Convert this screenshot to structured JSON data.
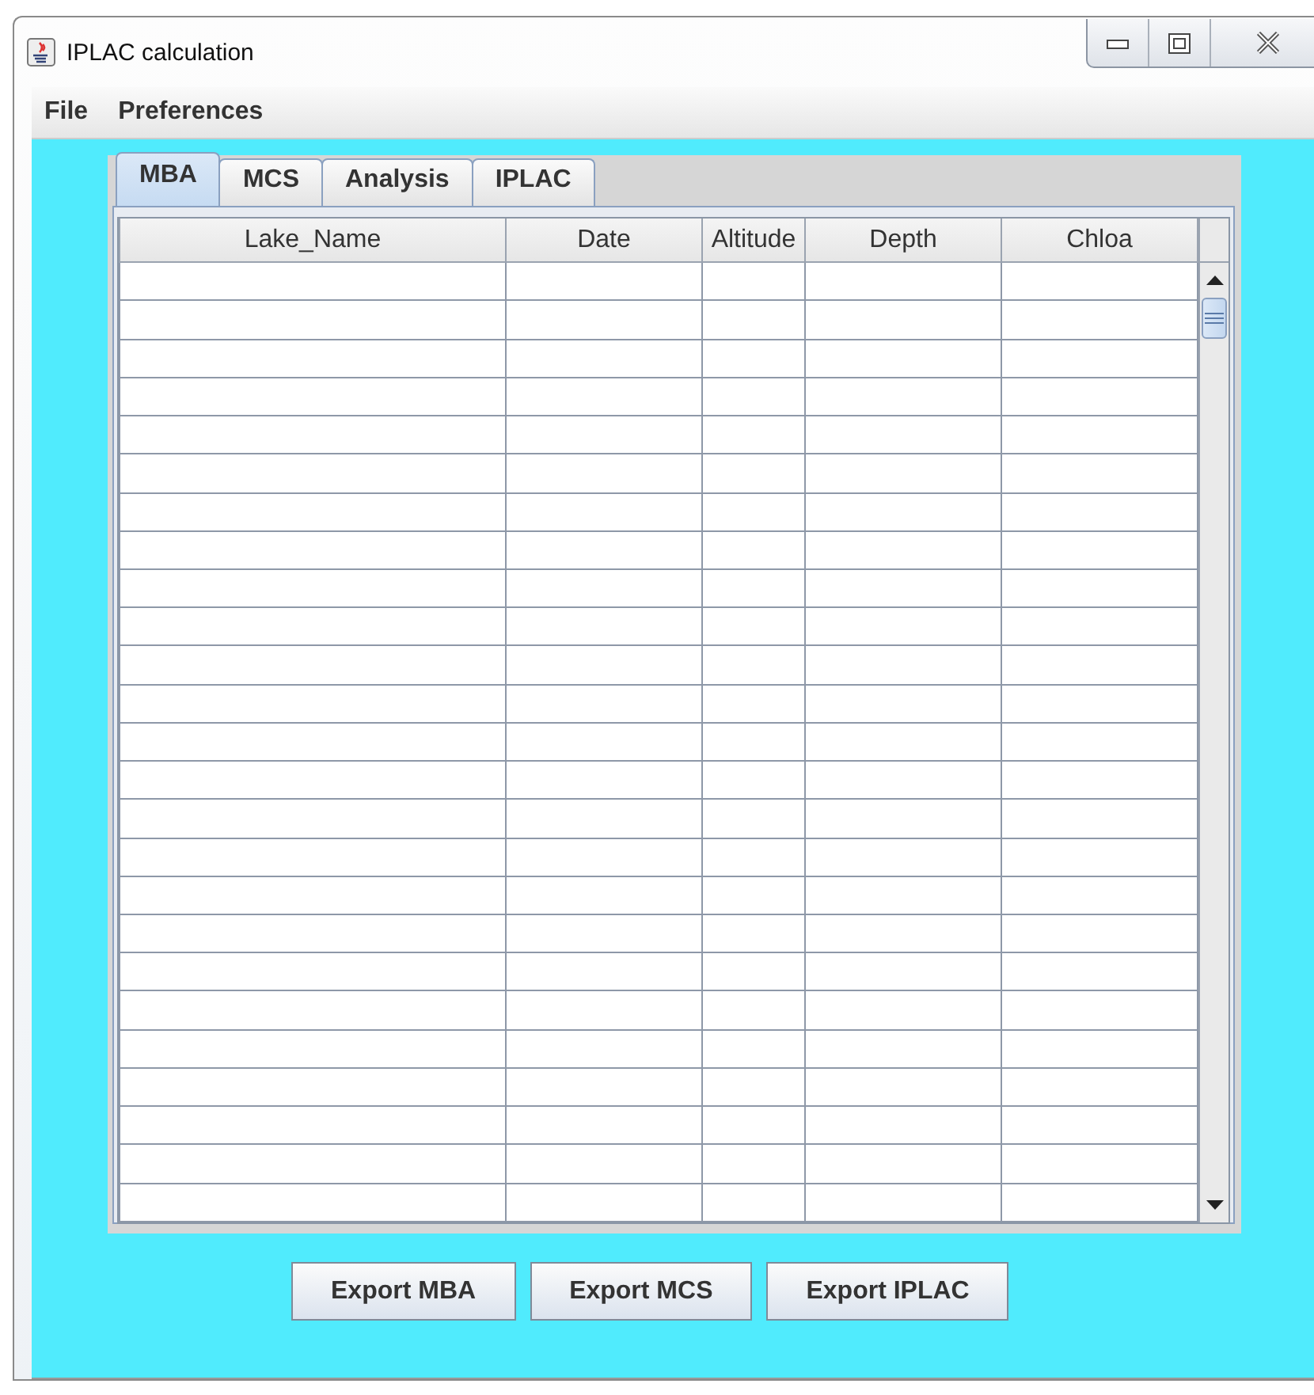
{
  "window": {
    "title": "IPLAC calculation"
  },
  "menu": [
    "File",
    "Preferences"
  ],
  "tabs": [
    {
      "label": "MBA",
      "selected": true
    },
    {
      "label": "MCS",
      "selected": false
    },
    {
      "label": "Analysis",
      "selected": false
    },
    {
      "label": "IPLAC",
      "selected": false
    }
  ],
  "table": {
    "columns": [
      "Lake_Name",
      "Date",
      "Altitude",
      "Depth",
      "Chloa"
    ]
  },
  "buttons": [
    "Export MBA",
    "Export MCS",
    "Export IPLAC"
  ]
}
